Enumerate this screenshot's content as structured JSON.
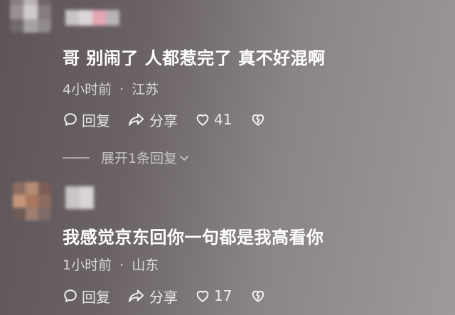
{
  "comments": [
    {
      "text": "哥 别闹了 人都惹完了 真不好混啊",
      "time": "4小时前",
      "location": "江苏",
      "reply_label": "回复",
      "share_label": "分享",
      "like_count": "41",
      "expand_replies_label": "展开1条回复"
    },
    {
      "text": "我感觉京东回你一句都是我高看你",
      "time": "1小时前",
      "location": "山东",
      "reply_label": "回复",
      "share_label": "分享",
      "like_count": "17"
    }
  ],
  "meta_separator": "·",
  "icons": {
    "reply": "comment-bubble-icon",
    "share": "share-arrow-icon",
    "like": "heart-icon",
    "dislike": "broken-heart-icon",
    "expand": "chevron-down-icon"
  },
  "colors": {
    "text_primary": "#ffffff",
    "text_secondary": "#e0dcde",
    "background_left": "#5d5458",
    "background_right": "#9e999c"
  }
}
